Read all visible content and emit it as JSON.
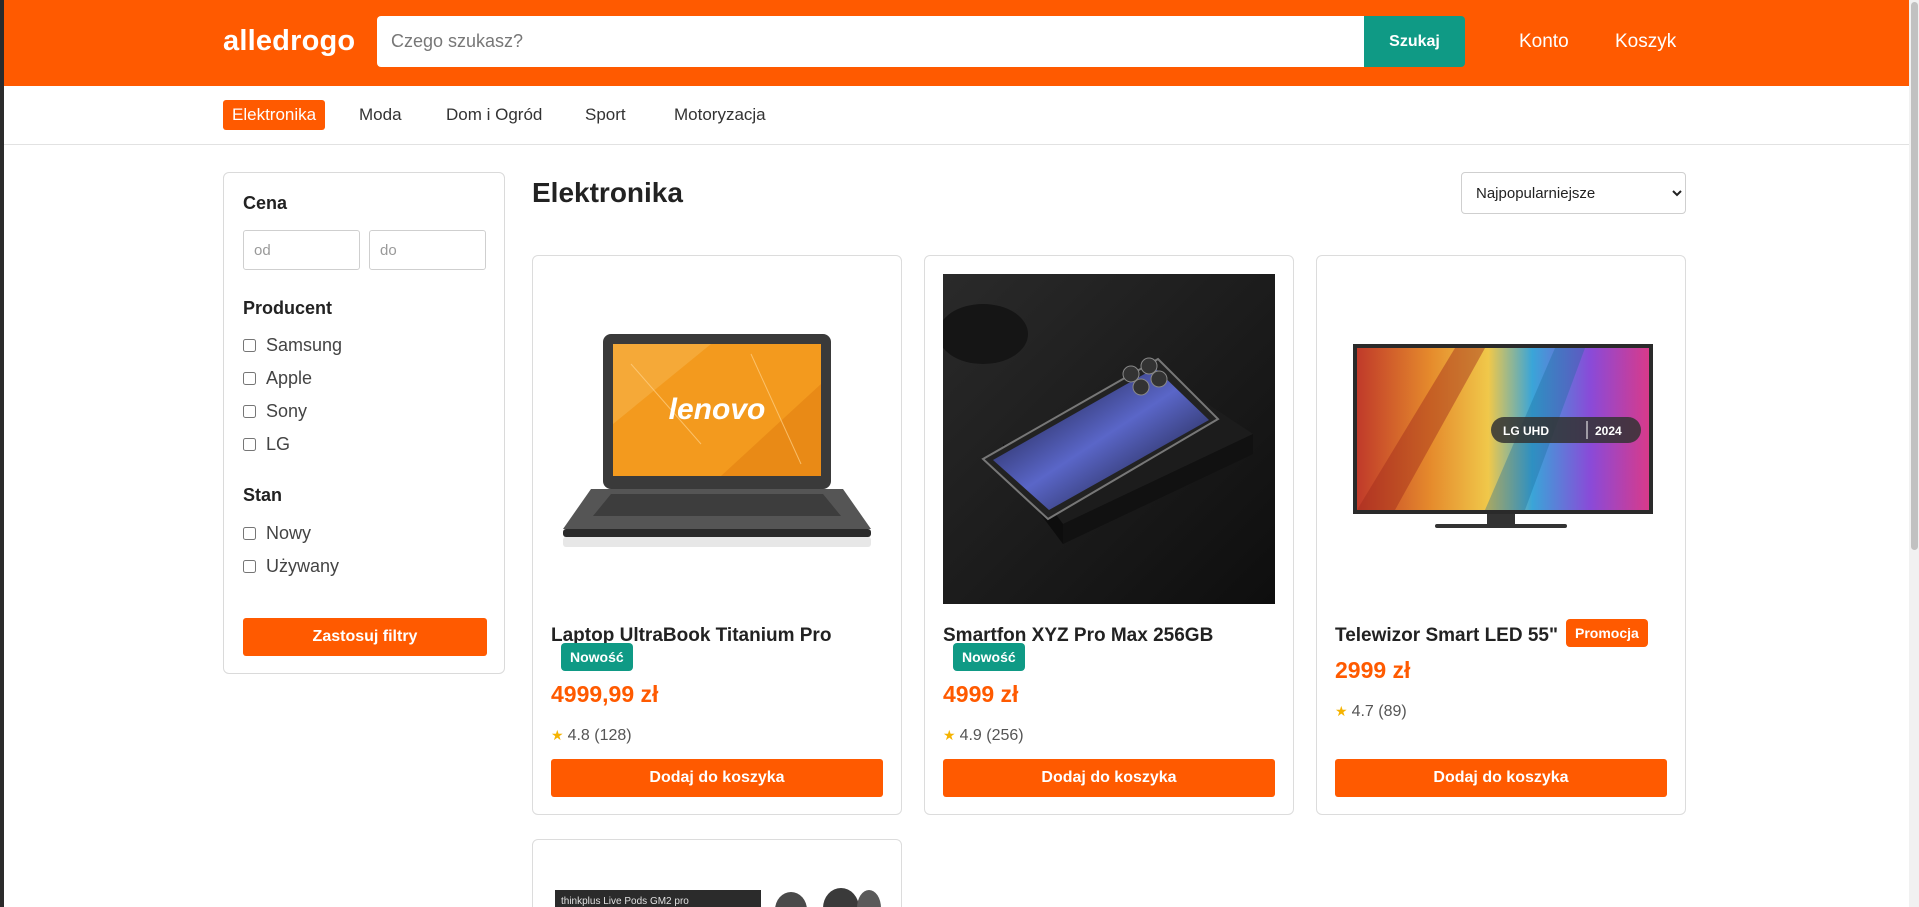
{
  "header": {
    "logo": "alledrogo",
    "search_placeholder": "Czego szukasz?",
    "search_button": "Szukaj",
    "account_link": "Konto",
    "cart_link": "Koszyk",
    "brand_color": "#ff5a00",
    "accent_color": "#0f9a85"
  },
  "categories": [
    {
      "label": "Elektronika",
      "active": true
    },
    {
      "label": "Moda",
      "active": false
    },
    {
      "label": "Dom i Ogród",
      "active": false
    },
    {
      "label": "Sport",
      "active": false
    },
    {
      "label": "Motoryzacja",
      "active": false
    }
  ],
  "filters": {
    "price_heading": "Cena",
    "price_from_placeholder": "od",
    "price_to_placeholder": "do",
    "producer_heading": "Producent",
    "producers": [
      "Samsung",
      "Apple",
      "Sony",
      "LG"
    ],
    "condition_heading": "Stan",
    "conditions": [
      "Nowy",
      "Używany"
    ],
    "apply_button": "Zastosuj filtry"
  },
  "main": {
    "title": "Elektronika",
    "sort_selected": "Najpopularniejsze"
  },
  "products": [
    {
      "name": "Laptop UltraBook Titanium Pro",
      "badge": "Nowość",
      "price": "4999,99 zł",
      "rating": "4.8 (128)",
      "button": "Dodaj do koszyka",
      "image": "laptop-image"
    },
    {
      "name": "Smartfon XYZ Pro Max 256GB",
      "badge": "Nowość",
      "price": "4999 zł",
      "rating": "4.9 (256)",
      "button": "Dodaj do koszyka",
      "image": "smartphone-image"
    },
    {
      "name": "Telewizor Smart LED 55\"",
      "badge": "Promocja",
      "price": "2999 zł",
      "rating": "4.7 (89)",
      "button": "Dodaj do koszyka",
      "image": "tv-image",
      "tv_brand": "LG UHD",
      "tv_year": "2024"
    },
    {
      "name": "",
      "image": "earbuds-image",
      "box_text": "thinkplus Live Pods GM2 pro"
    }
  ]
}
